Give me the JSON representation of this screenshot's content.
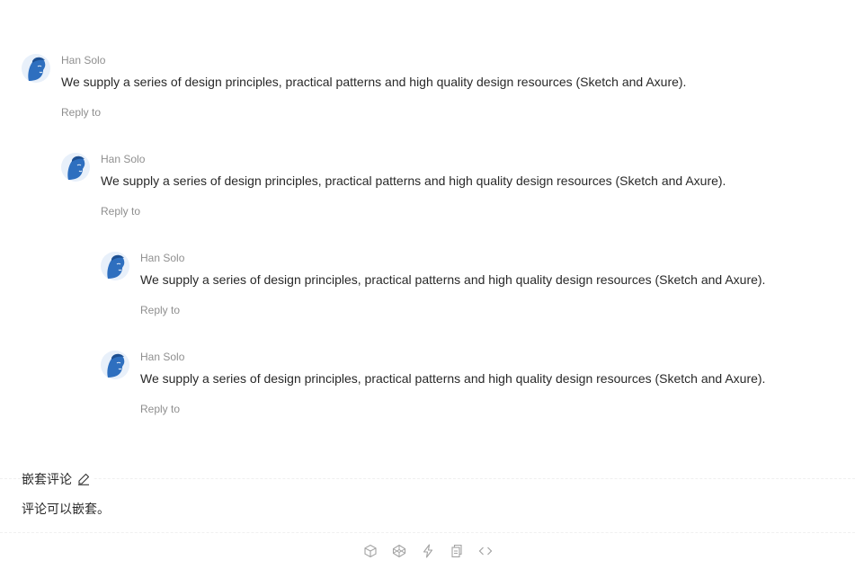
{
  "comments": [
    {
      "author": "Han Solo",
      "content": "We supply a series of design principles, practical patterns and high quality design resources (Sketch and Axure).",
      "reply_label": "Reply to"
    },
    {
      "author": "Han Solo",
      "content": "We supply a series of design principles, practical patterns and high quality design resources (Sketch and Axure).",
      "reply_label": "Reply to"
    },
    {
      "author": "Han Solo",
      "content": "We supply a series of design principles, practical patterns and high quality design resources (Sketch and Axure).",
      "reply_label": "Reply to"
    },
    {
      "author": "Han Solo",
      "content": "We supply a series of design principles, practical patterns and high quality design resources (Sketch and Axure).",
      "reply_label": "Reply to"
    }
  ],
  "demo": {
    "title": "嵌套评论",
    "description": "评论可以嵌套。",
    "actions": [
      "codesandbox-icon",
      "codepen-icon",
      "stackblitz-icon",
      "copy-icon",
      "code-icon"
    ]
  },
  "colors": {
    "avatar_blue": "#2e6fbf",
    "muted_text": "#8c8c8c",
    "icon_gray": "#a3a3a3"
  }
}
